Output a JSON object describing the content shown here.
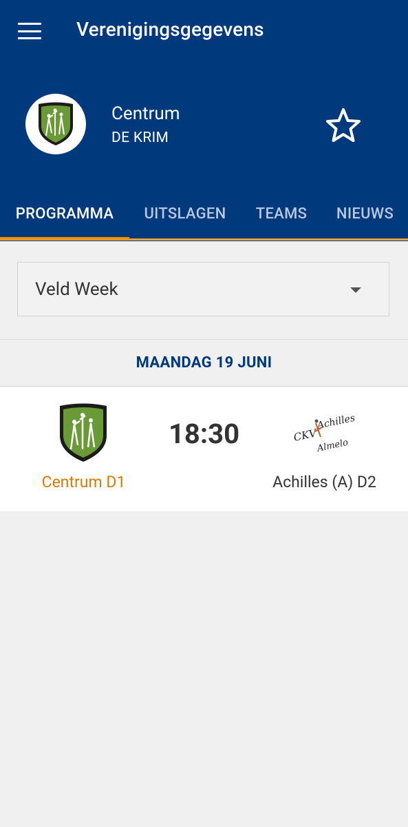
{
  "app": {
    "title": "Verenigingsgegevens"
  },
  "club": {
    "name": "Centrum",
    "city": "DE KRIM"
  },
  "tabs": [
    {
      "label": "PROGRAMMA",
      "active": true
    },
    {
      "label": "UITSLAGEN",
      "active": false
    },
    {
      "label": "TEAMS",
      "active": false
    },
    {
      "label": "NIEUWS",
      "active": false
    }
  ],
  "filter": {
    "selected": "Veld Week"
  },
  "schedule": {
    "day": "MAANDAG 19 JUNI",
    "match": {
      "time": "18:30",
      "home_team": "Centrum D1",
      "away_team": "Achilles (A) D2",
      "away_logo_text": [
        "CKV",
        "Achilles",
        "Almelo"
      ]
    }
  },
  "colors": {
    "primary": "#00397c",
    "accent": "#f39200",
    "home_team_text": "#d97b00",
    "crest_green": "#6a9a36"
  },
  "icons": {
    "menu": "menu-icon",
    "favorite": "star-outline-icon",
    "dropdown": "triangle-down-icon"
  }
}
